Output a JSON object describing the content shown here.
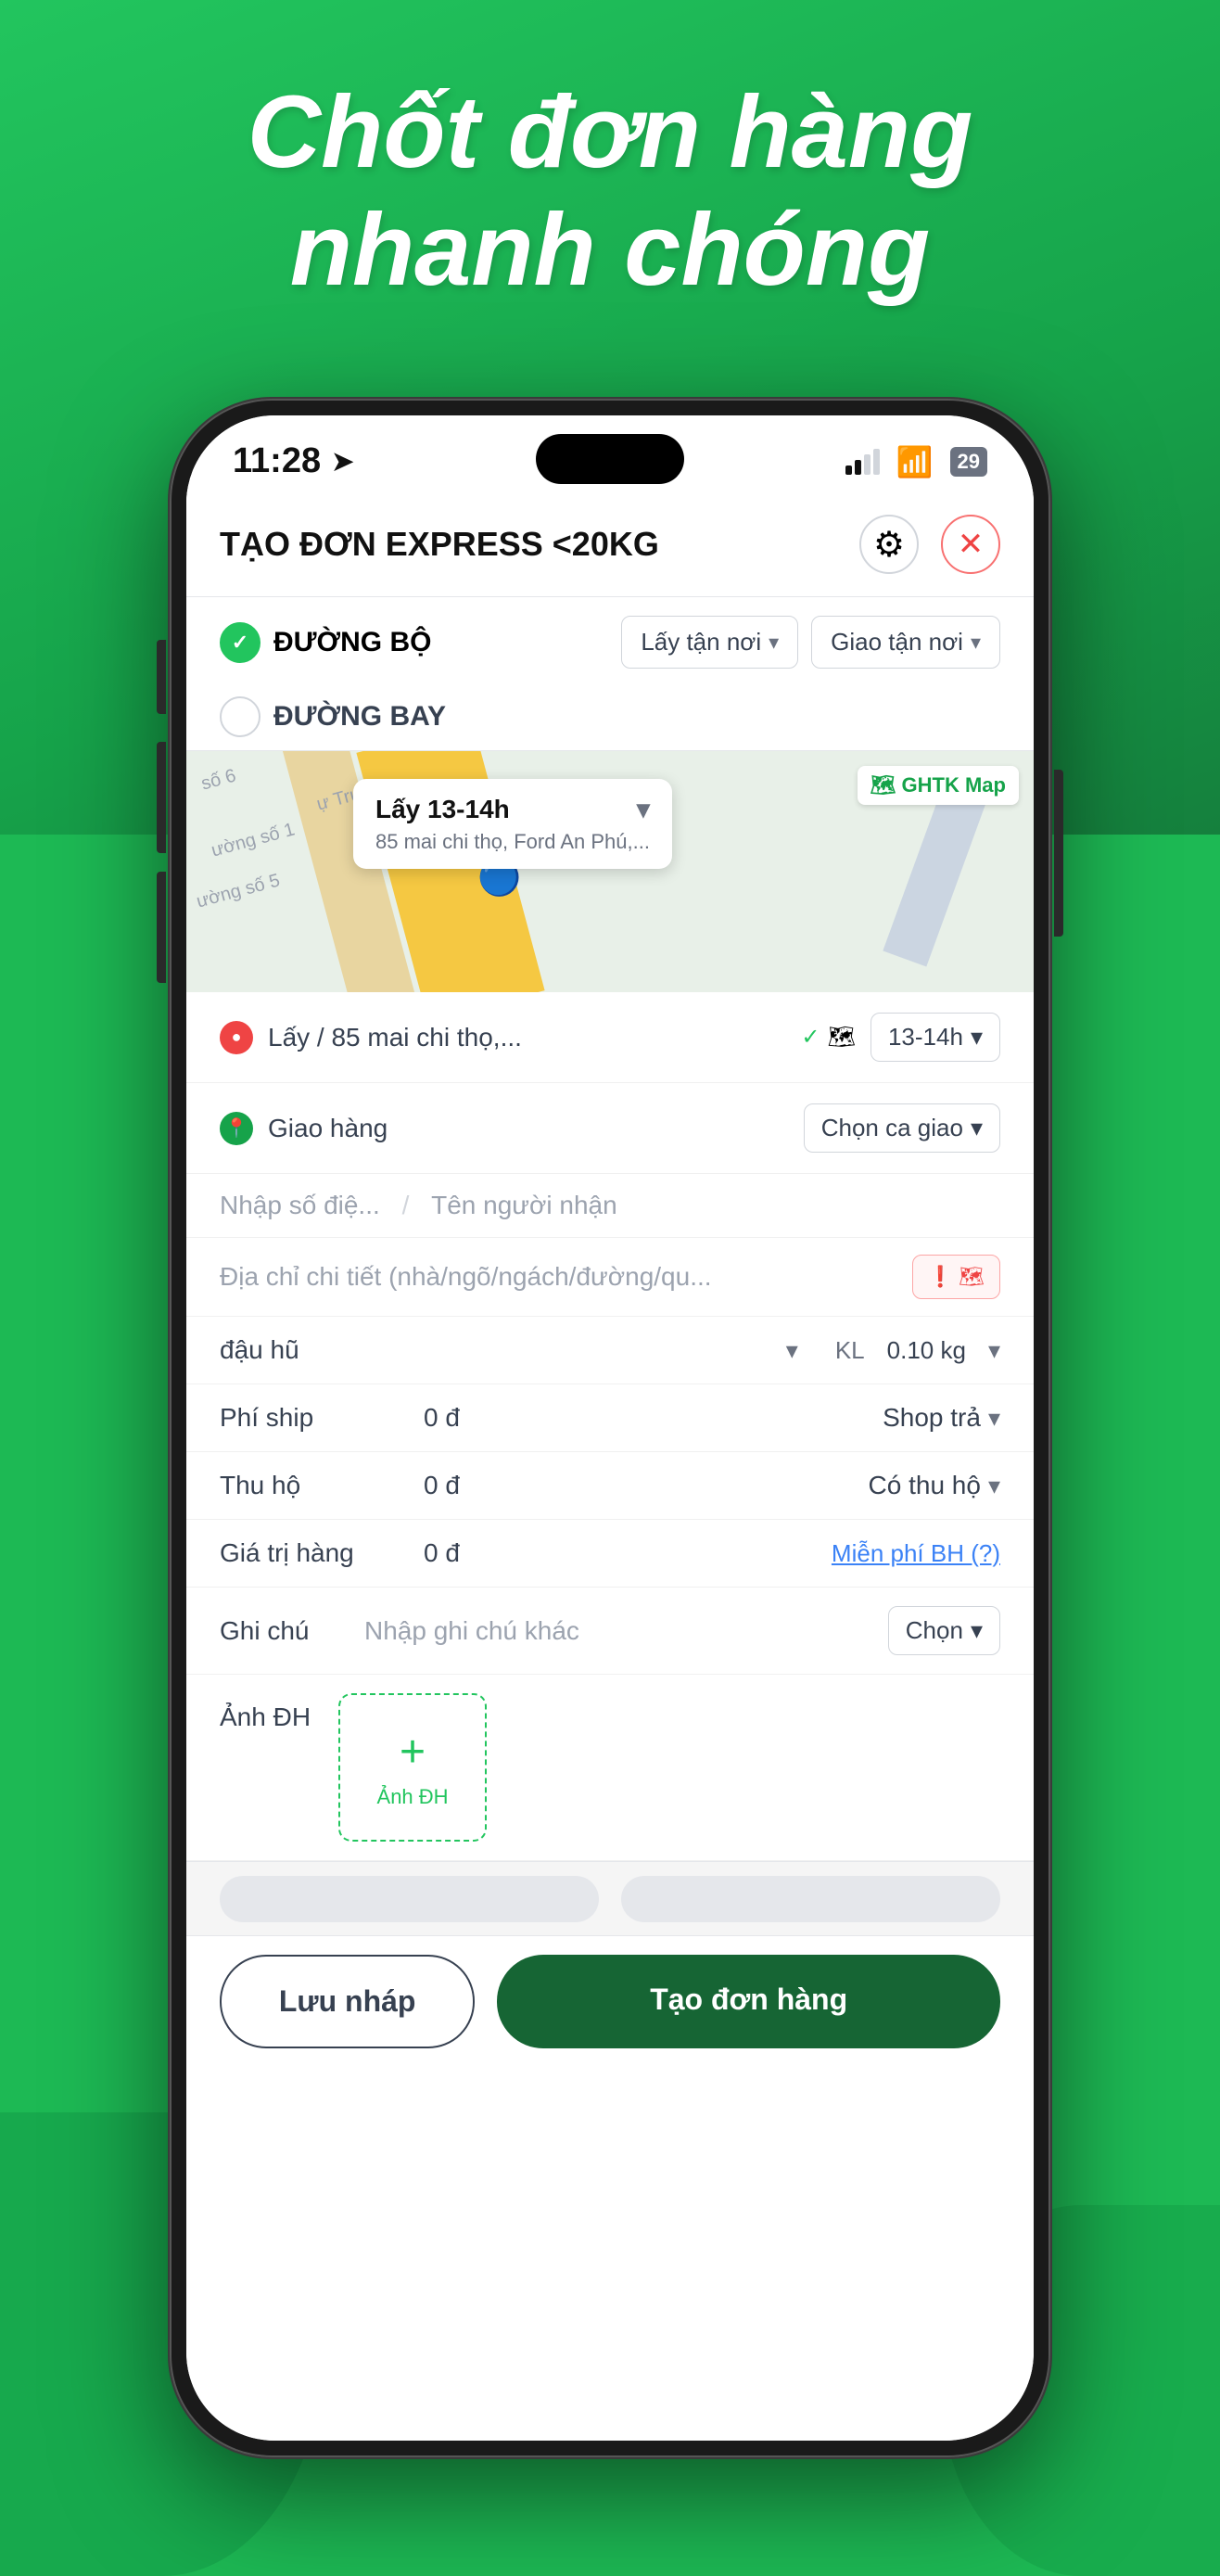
{
  "hero": {
    "line1": "Chốt đơn hàng",
    "line2": "nhanh chóng"
  },
  "status_bar": {
    "time": "11:28",
    "battery": "29"
  },
  "header": {
    "title": "TẠO ĐƠN EXPRESS <20KG",
    "gear_icon": "⚙",
    "close_icon": "✕"
  },
  "transport": {
    "road_label": "ĐƯỜNG BỘ",
    "air_label": "ĐƯỜNG BAY",
    "pickup_option": "Lấy tận nơi",
    "delivery_option": "Giao tận nơi"
  },
  "map": {
    "ghtk_label": "GHTK Map",
    "road_labels": [
      "số 6",
      "Trung",
      "số 1",
      "số 5"
    ],
    "popup_title": "Lấy 13-14h",
    "popup_subtitle": "85 mai chi thọ, Ford An Phú,..."
  },
  "pickup": {
    "text": "Lấy / 85 mai chi thọ,...",
    "time": "13-14h"
  },
  "delivery": {
    "label": "Giao hàng",
    "dropdown": "Chọn ca giao"
  },
  "inputs": {
    "phone_placeholder": "Nhập số điệ...",
    "name_placeholder": "Tên người nhận",
    "address_placeholder": "Địa chỉ chi tiết (nhà/ngõ/ngách/đường/qu...",
    "map_btn": "!🗺"
  },
  "product": {
    "name": "đậu hũ",
    "kl_label": "KL",
    "kl_value": "0.10 kg"
  },
  "fee_row": {
    "label": "Phí ship",
    "value": "0 đ",
    "right_label": "Shop trả",
    "right_chevron": "▾"
  },
  "cod_row": {
    "label": "Thu hộ",
    "value": "0 đ",
    "right_label": "Có thu hộ",
    "right_chevron": "▾"
  },
  "goods_row": {
    "label": "Giá trị hàng",
    "value": "0 đ",
    "link": "Miễn phí BH (?)"
  },
  "note_row": {
    "label": "Ghi chú",
    "input_placeholder": "Nhập ghi chú khác",
    "dropdown": "Chọn"
  },
  "image_row": {
    "label": "Ảnh ĐH",
    "upload_label": "Ảnh ĐH"
  },
  "buttons": {
    "save_draft": "Lưu nháp",
    "create_order": "Tạo đơn hàng"
  }
}
